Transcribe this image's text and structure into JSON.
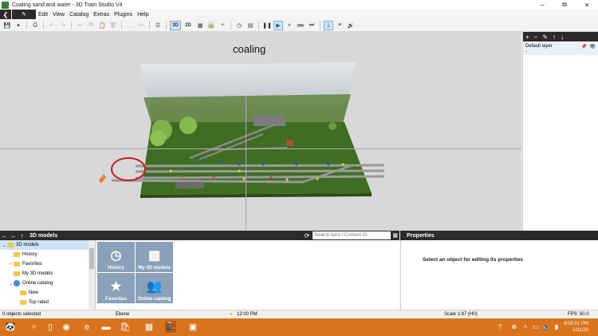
{
  "window": {
    "title": "Coaling sand and water - 3D Train Studio V4",
    "minimize": "─",
    "maximize": "⧉",
    "close": "✕"
  },
  "menu": {
    "back_icon": "❮",
    "pen_icon": "✎",
    "items": [
      "Edit",
      "View",
      "Catalog",
      "Extras",
      "Plugins",
      "Help"
    ]
  },
  "toolbar": {
    "btn_3d": "3D",
    "btn_2d": "2D"
  },
  "viewport": {
    "scene_title": "coaling"
  },
  "layers": {
    "tools": [
      "+",
      "−",
      "✎",
      "↑",
      "↓"
    ],
    "default_layer": "Default layer",
    "default_layer_sub": "-"
  },
  "library": {
    "title": "3D models",
    "search_placeholder": "Search term / Content ID",
    "tree": [
      {
        "label": "3D models",
        "type": "folder",
        "arrow": "⌄",
        "selected": true
      },
      {
        "label": "History",
        "type": "folder",
        "arrow": ""
      },
      {
        "label": "Favorites",
        "type": "folder",
        "arrow": "›"
      },
      {
        "label": "My 3D models",
        "type": "folder",
        "arrow": ""
      },
      {
        "label": "Online catalog",
        "type": "globe",
        "arrow": "⌄"
      },
      {
        "label": "New",
        "type": "folder",
        "arrow": ""
      },
      {
        "label": "Top rated",
        "type": "folder",
        "arrow": ""
      }
    ],
    "tiles": [
      "History",
      "My 3D models",
      "Favorites",
      "Online catalog"
    ]
  },
  "properties": {
    "title": "Properties",
    "message": "Select an object for editing its properties"
  },
  "status": {
    "selected": "0 objects selected",
    "layer": "Ebene",
    "time": "12:00 PM",
    "scale": "Scale 1:87 (H0)",
    "fps": "FPS: 60.0"
  },
  "taskbar": {
    "time": "9:55:01 PM",
    "date": "1/31/20"
  },
  "colors": {
    "accent": "#1560b8",
    "taskbar": "#d9731c",
    "grass": "#3f6e22",
    "panel_dark": "#2b2b2b"
  }
}
